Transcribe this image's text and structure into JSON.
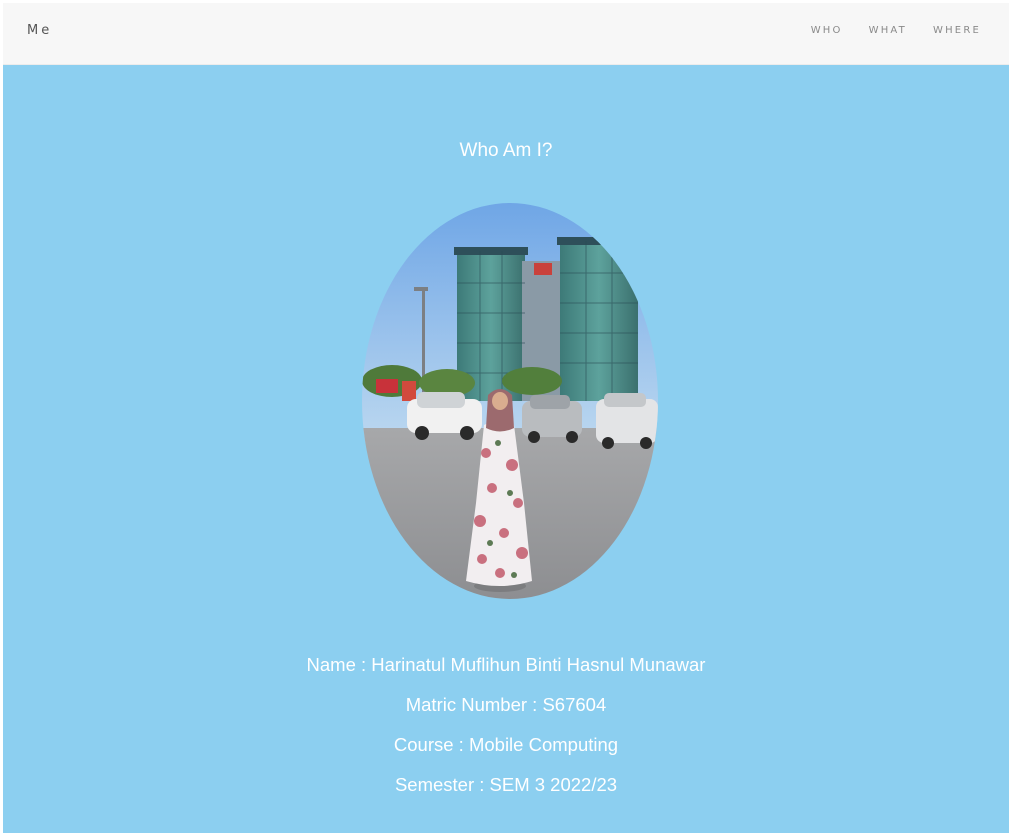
{
  "navbar": {
    "brand": "Me",
    "links": [
      "WHO",
      "WHAT",
      "WHERE"
    ]
  },
  "hero": {
    "title": "Who Am I?",
    "info": [
      "Name : Harinatul Muflihun Binti Hasnul Munawar",
      "Matric Number : S67604",
      "Course : Mobile Computing",
      "Semester : SEM 3 2022/23"
    ]
  },
  "colors": {
    "hero_background": "#8ccff0",
    "navbar_background": "#f7f7f7",
    "text_light": "#ffffff"
  }
}
